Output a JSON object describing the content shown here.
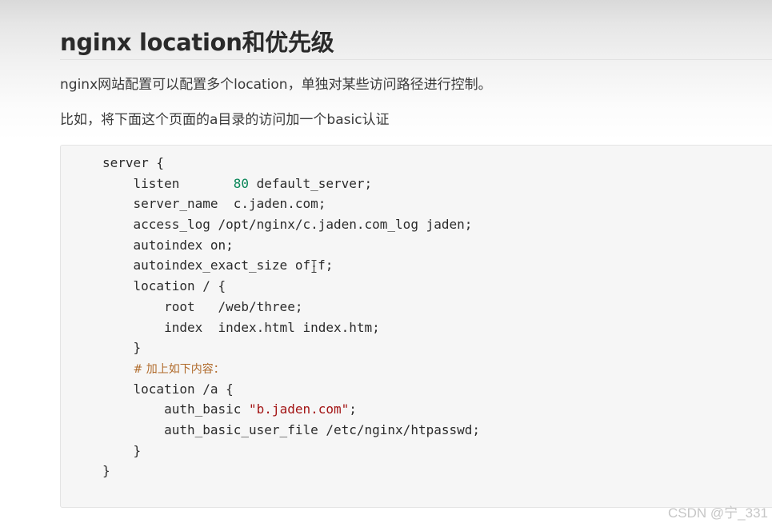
{
  "article": {
    "title": "nginx location和优先级",
    "paragraphs": [
      "nginx网站配置可以配置多个location，单独对某些访问路径进行控制。",
      "比如，将下面这个页面的a目录的访问加一个basic认证"
    ]
  },
  "code": {
    "lines": {
      "l1": "server {",
      "l2_a": "    listen       ",
      "l2_num": "80",
      "l2_b": " default_server;",
      "l3": "    server_name  c.jaden.com;",
      "l4": "    access_log /opt/nginx/c.jaden.com_log jaden;",
      "l5": "    autoindex on;",
      "l6_a": "    autoindex_exact_size of",
      "l6_b": "f;",
      "l7": "    location / {",
      "l8": "        root   /web/three;",
      "l9": "        index  index.html index.htm;",
      "l10": "    }",
      "l11_indent": "    ",
      "l11_comment": "# 加上如下内容：",
      "l12": "    location /a {",
      "l13_a": "        auth_basic ",
      "l13_str": "\"b.jaden.com\"",
      "l13_b": ";",
      "l14": "        auth_basic_user_file /etc/nginx/htpasswd;",
      "l15": "    }",
      "l16": "}"
    }
  },
  "watermark": "CSDN @宁_331",
  "colors": {
    "number": "#098658",
    "string": "#a31515",
    "comment": "#b06a2a"
  },
  "icons": [
    "text-cursor-icon"
  ]
}
